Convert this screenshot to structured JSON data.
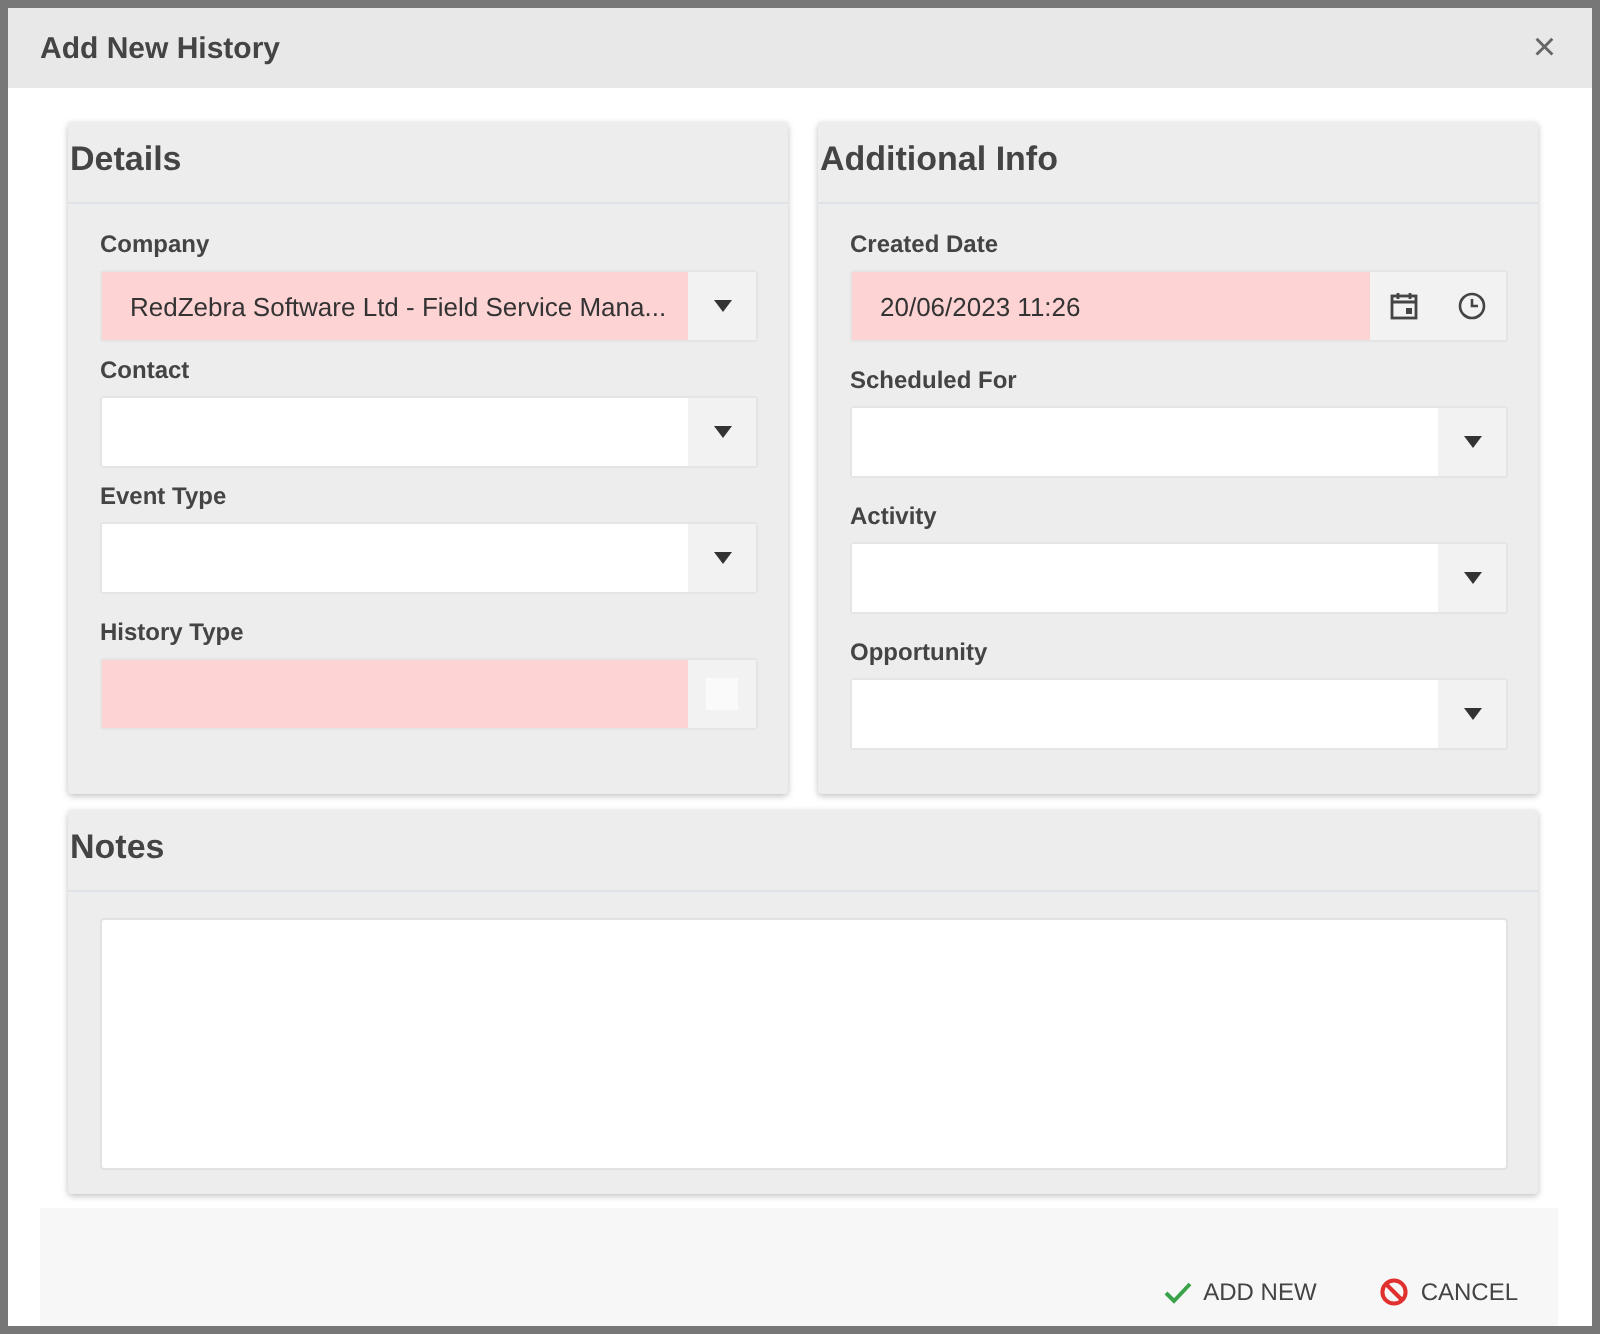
{
  "window": {
    "title": "Add New History",
    "close": "×"
  },
  "panels": [
    {
      "title": "Details",
      "fields": [
        {
          "label": "Company",
          "kind": "dropdown",
          "value": "RedZebra Software Ltd - Field Service Mana...",
          "required": true
        },
        {
          "label": "Contact",
          "kind": "dropdown",
          "required": false
        },
        {
          "label": "Event Type",
          "kind": "dropdown",
          "required": false
        },
        {
          "label": "History Type",
          "kind": "lookup",
          "required": true
        }
      ]
    },
    {
      "title": "Additional Info",
      "fields": [
        {
          "label": "Created Date",
          "kind": "datetime",
          "value": "20/06/2023 11:26",
          "required": true
        },
        {
          "label": "Scheduled For",
          "kind": "dropdown",
          "required": false
        },
        {
          "label": "Activity",
          "kind": "dropdown",
          "required": false
        },
        {
          "label": "Opportunity",
          "kind": "dropdown",
          "required": false
        }
      ]
    }
  ],
  "notes": {
    "title": "Notes"
  },
  "buttons": [
    {
      "label": "ADD NEW",
      "kind": "confirm"
    },
    {
      "label": "CANCEL",
      "kind": "cancel"
    }
  ]
}
